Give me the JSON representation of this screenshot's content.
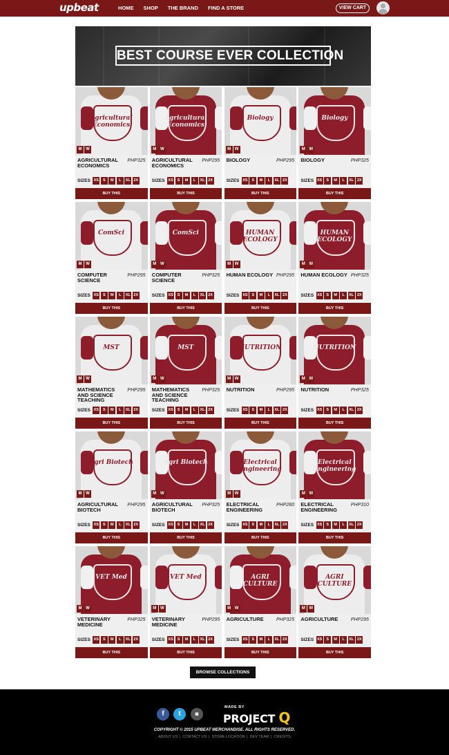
{
  "nav": {
    "logo": "upbeat",
    "links": [
      "HOME",
      "SHOP",
      "THE BRAND",
      "FIND A STORE"
    ],
    "cart_label": "VIEW CART"
  },
  "banner": {
    "title": "BEST COURSE EVER COLLECTION"
  },
  "products": [
    {
      "name": "AGRICULTURAL ECONOMICS",
      "price": "PHP325",
      "color": "white",
      "graphic": "Agricultural Economics"
    },
    {
      "name": "AGRICULTURAL ECONOMICS",
      "price": "PHP295",
      "color": "red",
      "graphic": "Agricultural Economics"
    },
    {
      "name": "BIOLOGY",
      "price": "PHP295",
      "color": "white",
      "graphic": "Biology"
    },
    {
      "name": "BIOLOGY",
      "price": "PHP325",
      "color": "red",
      "graphic": "Biology"
    },
    {
      "name": "COMPUTER SCIENCE",
      "price": "PHP295",
      "color": "white",
      "graphic": "ComSci"
    },
    {
      "name": "COMPUTER SCIENCE",
      "price": "PHP325",
      "color": "red",
      "graphic": "ComSci"
    },
    {
      "name": "HUMAN ECOLOGY",
      "price": "PHP295",
      "color": "white",
      "graphic": "HUMAN ECOLOGY"
    },
    {
      "name": "HUMAN ECOLOGY",
      "price": "PHP325",
      "color": "red",
      "graphic": "HUMAN ECOLOGY"
    },
    {
      "name": "MATHEMATICS AND SCIENCE TEACHING",
      "price": "PHP295",
      "color": "white",
      "graphic": "MST"
    },
    {
      "name": "MATHEMATICS AND SCIENCE TEACHING",
      "price": "PHP325",
      "color": "red",
      "graphic": "MST"
    },
    {
      "name": "NUTRITION",
      "price": "PHP295",
      "color": "white",
      "graphic": "NUTRITION"
    },
    {
      "name": "NUTRITION",
      "price": "PHP325",
      "color": "red",
      "graphic": "NUTRITION"
    },
    {
      "name": "AGRICULTURAL BIOTECH",
      "price": "PHP295",
      "color": "white",
      "graphic": "Agri Biotech"
    },
    {
      "name": "AGRICULTURAL BIOTECH",
      "price": "PHP325",
      "color": "red",
      "graphic": "Agri Biotech"
    },
    {
      "name": "ELECTRICAL ENGINEERING",
      "price": "PHP280",
      "color": "white",
      "graphic": "Electrical Engineering"
    },
    {
      "name": "ELECTRICAL ENGINEERING",
      "price": "PHP310",
      "color": "red",
      "graphic": "Electrical Engineering"
    },
    {
      "name": "VETERINARY MEDICINE",
      "price": "PHP325",
      "color": "red",
      "graphic": "VET Med"
    },
    {
      "name": "VETERINARY MEDICINE",
      "price": "PHP295",
      "color": "white",
      "graphic": "VET Med"
    },
    {
      "name": "AGRICULTURE",
      "price": "PHP325",
      "color": "red",
      "graphic": "AGRI CULTURE"
    },
    {
      "name": "AGRICULTURE",
      "price": "PHP295",
      "color": "white",
      "graphic": "AGRI CULTURE"
    }
  ],
  "sex_labels": [
    "M",
    "W"
  ],
  "sizes_label": "SIZES",
  "sizes": [
    "XS",
    "S",
    "M",
    "L",
    "XL",
    "2X"
  ],
  "buy_label": "BUY THIS",
  "browse_label": "BROWSE COLLECTIONS",
  "footer": {
    "made_by": "MADE BY",
    "brand": "PROJECT",
    "brand_q": "Q",
    "copyright": "COPYRIGHT © 2015 UPBEAT MERCHANDISE. ALL RIGHTS RESERVED.",
    "links": [
      "ABOUT US",
      "CONTACT US",
      "STORE LOCATION",
      "DEV TEAM",
      "CREDITS"
    ]
  },
  "colors": {
    "brand": "#7a1818",
    "shirt_red": "#8e1d2b",
    "shirt_white": "#ededed"
  }
}
